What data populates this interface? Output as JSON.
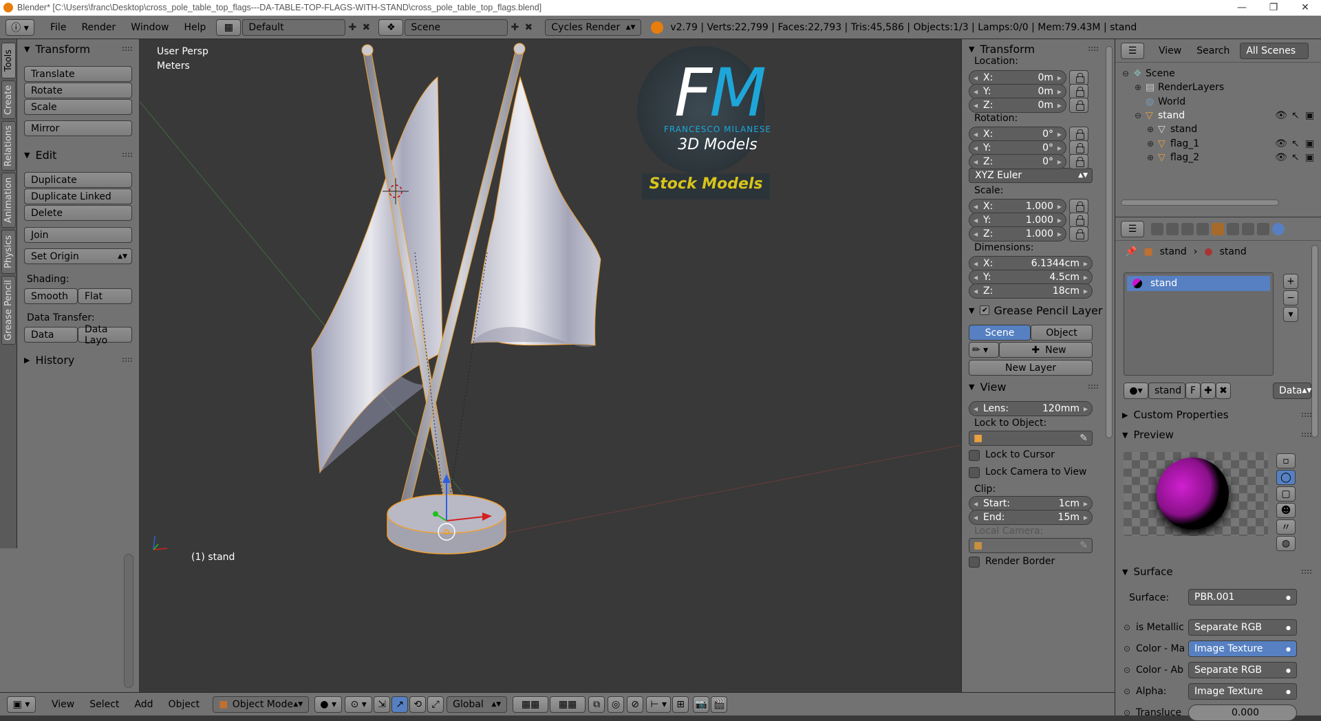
{
  "window": {
    "title": "Blender* [C:\\Users\\franc\\Desktop\\cross_pole_table_top_flags---DA-TABLE-TOP-FLAGS-WITH-STAND\\cross_pole_table_top_flags.blend]",
    "controls": [
      "—",
      "❐",
      "✕"
    ]
  },
  "info_header": {
    "menus": [
      "File",
      "Render",
      "Window",
      "Help"
    ],
    "screen_layout": "Default",
    "scene": "Scene",
    "render_engine": "Cycles Render",
    "stats": "v2.79 | Verts:22,799 | Faces:22,793 | Tris:45,586 | Objects:1/3 | Lamps:0/0 | Mem:79.43M | stand"
  },
  "side_tabs": [
    "Tools",
    "Create",
    "Relations",
    "Animation",
    "Physics",
    "Grease Pencil"
  ],
  "tool_shelf": {
    "transform": {
      "title": "Transform",
      "buttons": [
        "Translate",
        "Rotate",
        "Scale",
        "Mirror"
      ]
    },
    "edit": {
      "title": "Edit",
      "buttons": [
        "Duplicate",
        "Duplicate Linked",
        "Delete",
        "Join",
        "Set Origin"
      ]
    },
    "shading_label": "Shading:",
    "shading": [
      "Smooth",
      "Flat"
    ],
    "data_transfer_label": "Data Transfer:",
    "data_transfer": [
      "Data",
      "Data Layo"
    ],
    "history": "History"
  },
  "viewport": {
    "view_name": "User Persp",
    "units": "Meters",
    "selected_object": "(1) stand",
    "watermark": {
      "initials": "FM",
      "name": "FRANCESCO MILANESE",
      "sub": "3D Models",
      "banner": "Stock Models"
    }
  },
  "n_panel": {
    "transform_title": "Transform",
    "location_label": "Location:",
    "location": [
      {
        "k": "X:",
        "v": "0m"
      },
      {
        "k": "Y:",
        "v": "0m"
      },
      {
        "k": "Z:",
        "v": "0m"
      }
    ],
    "rotation_label": "Rotation:",
    "rotation": [
      {
        "k": "X:",
        "v": "0°"
      },
      {
        "k": "Y:",
        "v": "0°"
      },
      {
        "k": "Z:",
        "v": "0°"
      }
    ],
    "rotation_mode": "XYZ Euler",
    "scale_label": "Scale:",
    "scale": [
      {
        "k": "X:",
        "v": "1.000"
      },
      {
        "k": "Y:",
        "v": "1.000"
      },
      {
        "k": "Z:",
        "v": "1.000"
      }
    ],
    "dimensions_label": "Dimensions:",
    "dimensions": [
      {
        "k": "X:",
        "v": "6.1344cm"
      },
      {
        "k": "Y:",
        "v": "4.5cm"
      },
      {
        "k": "Z:",
        "v": "18cm"
      }
    ],
    "grease_pencil_title": "Grease Pencil Layer",
    "gp_scene": "Scene",
    "gp_object": "Object",
    "gp_new": "New",
    "gp_new_layer": "New Layer",
    "view_title": "View",
    "lens_label": "Lens:",
    "lens_value": "120mm",
    "lock_to_object_label": "Lock to Object:",
    "lock_to_cursor": "Lock to Cursor",
    "lock_camera": "Lock Camera to View",
    "clip_label": "Clip:",
    "clip_start_label": "Start:",
    "clip_start": "1cm",
    "clip_end_label": "End:",
    "clip_end": "15m",
    "local_camera_label": "Local Camera:",
    "render_border": "Render Border"
  },
  "outliner": {
    "menus": [
      "View",
      "Search"
    ],
    "filter": "All Scenes",
    "items": [
      {
        "label": "Scene",
        "indent": 0
      },
      {
        "label": "RenderLayers",
        "indent": 1
      },
      {
        "label": "World",
        "indent": 1
      },
      {
        "label": "stand",
        "indent": 1
      },
      {
        "label": "stand",
        "indent": 2
      },
      {
        "label": "flag_1",
        "indent": 2
      },
      {
        "label": "flag_2",
        "indent": 2
      }
    ]
  },
  "properties": {
    "breadcrumb": [
      "stand",
      "stand"
    ],
    "material_slot": "stand",
    "material_name": "stand",
    "material_f": "F",
    "link": "Data",
    "custom_properties": "Custom Properties",
    "preview": "Preview",
    "surface_title": "Surface",
    "surface_label": "Surface:",
    "surface_value": "PBR.001",
    "inputs": [
      {
        "label": "is Metallic",
        "value": "Separate RGB",
        "highlight": false
      },
      {
        "label": "Color - Ma",
        "value": "Image Texture",
        "highlight": true
      },
      {
        "label": "Color - Ab",
        "value": "Separate RGB",
        "highlight": false
      },
      {
        "label": "Alpha:",
        "value": "Image Texture",
        "highlight": false
      },
      {
        "label": "Transluce",
        "value": "0.000",
        "highlight": false
      }
    ]
  },
  "bottom_header": {
    "menus": [
      "View",
      "Select",
      "Add",
      "Object"
    ],
    "mode": "Object Mode",
    "orientation": "Global"
  },
  "colors": {
    "accent": "#5680c2",
    "watermark_blue": "#1ea6d9",
    "stock_yellow": "#d8c41b",
    "origin_orange": "#f39c12"
  }
}
